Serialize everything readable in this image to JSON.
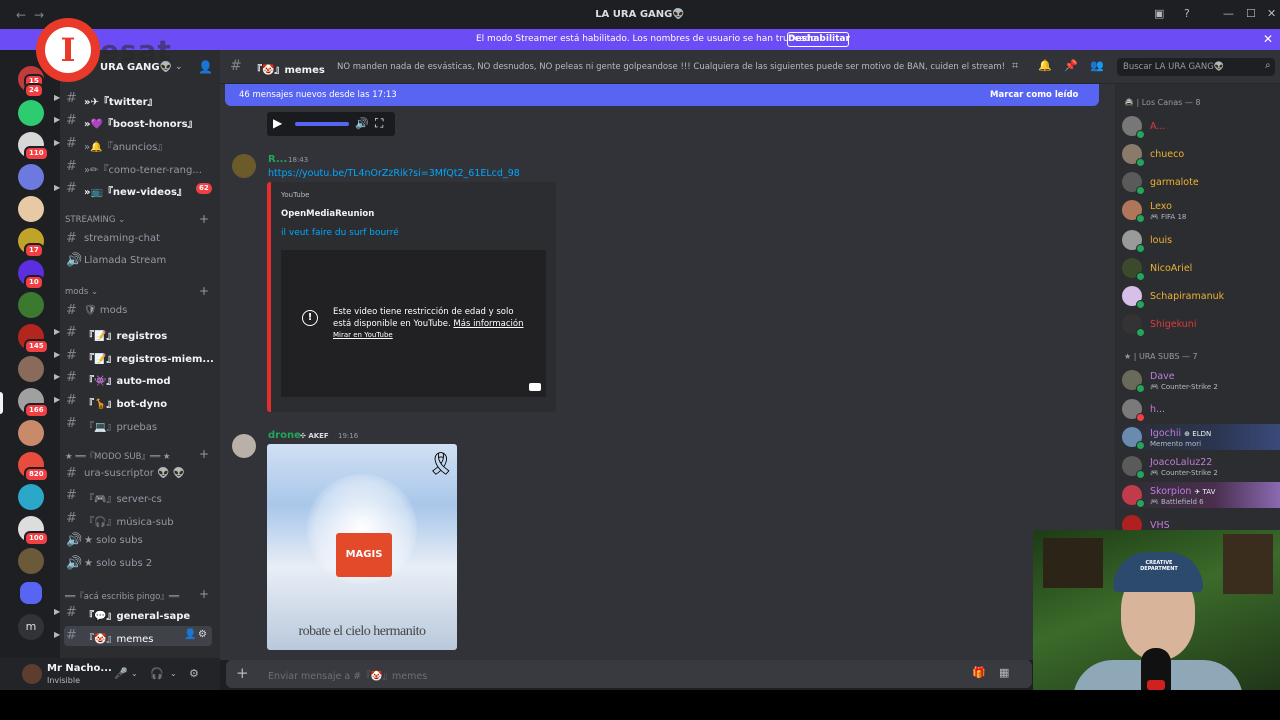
{
  "window": {
    "title": "LA URA GANG👽",
    "back": "←",
    "forward": "→"
  },
  "banner": {
    "text": "El modo Streamer está habilitado. Los nombres de usuario se han truncado.",
    "button": "Deshabilitar",
    "close": "✕"
  },
  "watermark": {
    "letter": "I",
    "text": "esat"
  },
  "guilds": {
    "badges": [
      "15",
      "24",
      "110",
      "17",
      "10",
      "145",
      "166",
      "820",
      "100"
    ],
    "letter_m": "m"
  },
  "server": {
    "name": "URA GANG👽"
  },
  "channels": {
    "top": [
      {
        "label": "»✈『twitter』",
        "bold": true
      },
      {
        "label": "»💜『boost-honors』",
        "bold": true
      },
      {
        "label": "»🔔『anuncios』",
        "bold": false
      },
      {
        "label": "»✏『como-tener-rang...",
        "bold": false
      },
      {
        "label": "»📺『new-videos』",
        "bold": true,
        "badge": "62"
      }
    ],
    "cat_streaming": "STREAMING",
    "streaming": [
      {
        "label": "streaming-chat",
        "type": "text"
      },
      {
        "label": "Llamada Stream",
        "type": "voice"
      }
    ],
    "cat_mods": "mods",
    "mods": [
      {
        "label": "🛡 mods",
        "bold": false
      },
      {
        "label": "『📝』registros",
        "bold": true
      },
      {
        "label": "『📝』registros-miem...",
        "bold": true
      },
      {
        "label": "『👾』auto-mod",
        "bold": true
      },
      {
        "label": "『🦒』bot-dyno",
        "bold": true
      },
      {
        "label": "『💻』pruebas",
        "bold": false
      }
    ],
    "cat_sub": "★ ══『MODO SUB』══ ★",
    "sub": [
      {
        "label": "ura-suscriptor 👽 👽",
        "type": "text"
      },
      {
        "label": "『🎮』server-cs",
        "type": "text"
      },
      {
        "label": "『🎧』música-sub",
        "type": "text"
      },
      {
        "label": "★ solo subs",
        "type": "voice"
      },
      {
        "label": "★ solo subs 2",
        "type": "voice"
      }
    ],
    "cat_pingo": "══『acá escribis pingo』══",
    "pingo": [
      {
        "label": "『💬』general-sape",
        "bold": true
      },
      {
        "label": "『🤡』memes",
        "selected": true
      }
    ]
  },
  "user": {
    "name": "Mr Nacho...",
    "status": "Invisible"
  },
  "header": {
    "channel": "『🤡』memes",
    "topic": "NO manden nada de esvásticas, NO desnudos, NO peleas ni gente golpeandose !!! Cualquiera de las siguientes puede ser motivo de BAN, cuiden el stream!"
  },
  "search": {
    "placeholder": "Buscar LA URA GANG👽"
  },
  "chat": {
    "new_messages": "46 mensajes nuevos desde las 17:13",
    "mark_read": "Marcar como leído",
    "msg1": {
      "author": "R...",
      "time": "18:43",
      "link": "https://youtu.be/TL4nOrZzRik?si=3MfQt2_61ELcd_98",
      "embed_provider": "YouTube",
      "embed_author": "OpenMediaReunion",
      "embed_title": "il veut faire du surf bourré",
      "restriction_text": "Este video tiene restricción de edad y solo está disponible en YouTube.",
      "more_info": "Más información",
      "watch_on": "Mirar en YouTube"
    },
    "msg2": {
      "author": "drone",
      "tag": "AKEF",
      "time": "19:16",
      "image_caption": "robate el cielo hermanito",
      "image_logo": "MAGIS"
    }
  },
  "composer": {
    "placeholder": "Enviar mensaje a #『🤡』memes"
  },
  "members": {
    "cat1": "🚔 | Los Canas — 8",
    "group1": [
      {
        "name": "A...",
        "color": "#e03b3b",
        "activity": ""
      },
      {
        "name": "chueco",
        "color": "#f0b232",
        "activity": ""
      },
      {
        "name": "garmalote",
        "color": "#f0b232",
        "activity": ""
      },
      {
        "name": "Lexo",
        "color": "#f0b232",
        "activity": "FIFA 18"
      },
      {
        "name": "louis",
        "color": "#f0b232",
        "activity": ""
      },
      {
        "name": "NicoAriel",
        "color": "#f0b232",
        "activity": ""
      },
      {
        "name": "Schapiramanuk",
        "color": "#f0b232",
        "activity": ""
      },
      {
        "name": "Shigekuni",
        "color": "#e03b3b",
        "activity": ""
      }
    ],
    "cat2": "★ | URA SUBS — 7",
    "group2": [
      {
        "name": "Dave",
        "color": "#c27cdb",
        "activity": "Counter-Strike 2",
        "tag": ""
      },
      {
        "name": "h...",
        "color": "#c27cdb",
        "activity": "",
        "tag": ""
      },
      {
        "name": "Igochii",
        "color": "#c27cdb",
        "activity": "Memento mori",
        "tag": "ELDN"
      },
      {
        "name": "JoacoLaluz22",
        "color": "#c27cdb",
        "activity": "Counter-Strike 2",
        "tag": ""
      },
      {
        "name": "Skorpion",
        "color": "#c27cdb",
        "activity": "Battlefield 6",
        "tag": "TAV"
      },
      {
        "name": "VHS",
        "color": "#c27cdb",
        "activity": "",
        "tag": ""
      }
    ]
  },
  "webcam": {
    "cap_text": "CREATIVE DEPARTMENT"
  }
}
